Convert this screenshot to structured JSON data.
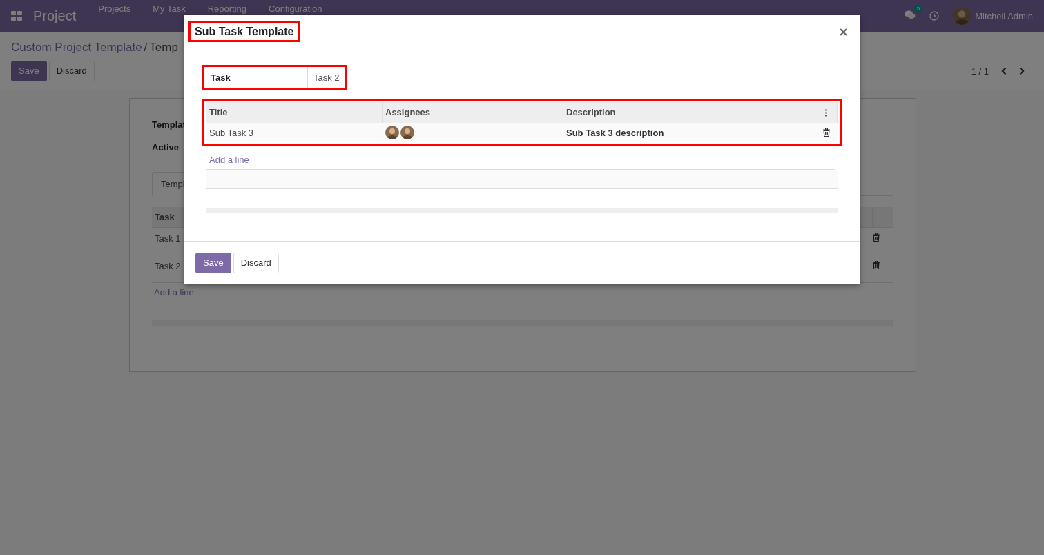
{
  "navbar": {
    "app_name": "Project",
    "menu": [
      {
        "label": "Projects"
      },
      {
        "label": "My Task"
      },
      {
        "label": "Reporting"
      },
      {
        "label": "Configuration"
      }
    ],
    "messages_badge": "5",
    "user_name": "Mitchell Admin"
  },
  "breadcrumb": {
    "parent": "Custom Project Template",
    "separator": "/",
    "current": "Temp"
  },
  "actions": [
    {
      "label": "Save",
      "kind": "primary"
    },
    {
      "label": "Discard",
      "kind": "secondary"
    }
  ],
  "pager": "1 / 1",
  "form": {
    "fields": [
      {
        "label": "Templat"
      },
      {
        "label": "Active"
      }
    ],
    "tabs": [
      {
        "label": "Templ",
        "selected": true
      }
    ],
    "table": {
      "columns": [
        "Task"
      ],
      "rows": [
        {
          "task": "Task 1"
        },
        {
          "task": "Task 2"
        }
      ],
      "add_line": "Add a line"
    }
  },
  "dialog": {
    "title": "Sub Task Template",
    "title_highlighted": true,
    "field": {
      "label": "Task",
      "value": "Task 2",
      "highlighted": true
    },
    "table": {
      "highlighted": true,
      "columns": [
        "Title",
        "Assignees",
        "Description"
      ],
      "rows": [
        {
          "title": "Sub Task 3",
          "assignees": [
            {
              "kind": "avatar"
            },
            {
              "kind": "avatar"
            }
          ],
          "description": "Sub Task 3 description"
        }
      ],
      "add_line": "Add a line"
    },
    "buttons": [
      {
        "label": "Save",
        "kind": "primary"
      },
      {
        "label": "Discard",
        "kind": "secondary"
      }
    ]
  }
}
